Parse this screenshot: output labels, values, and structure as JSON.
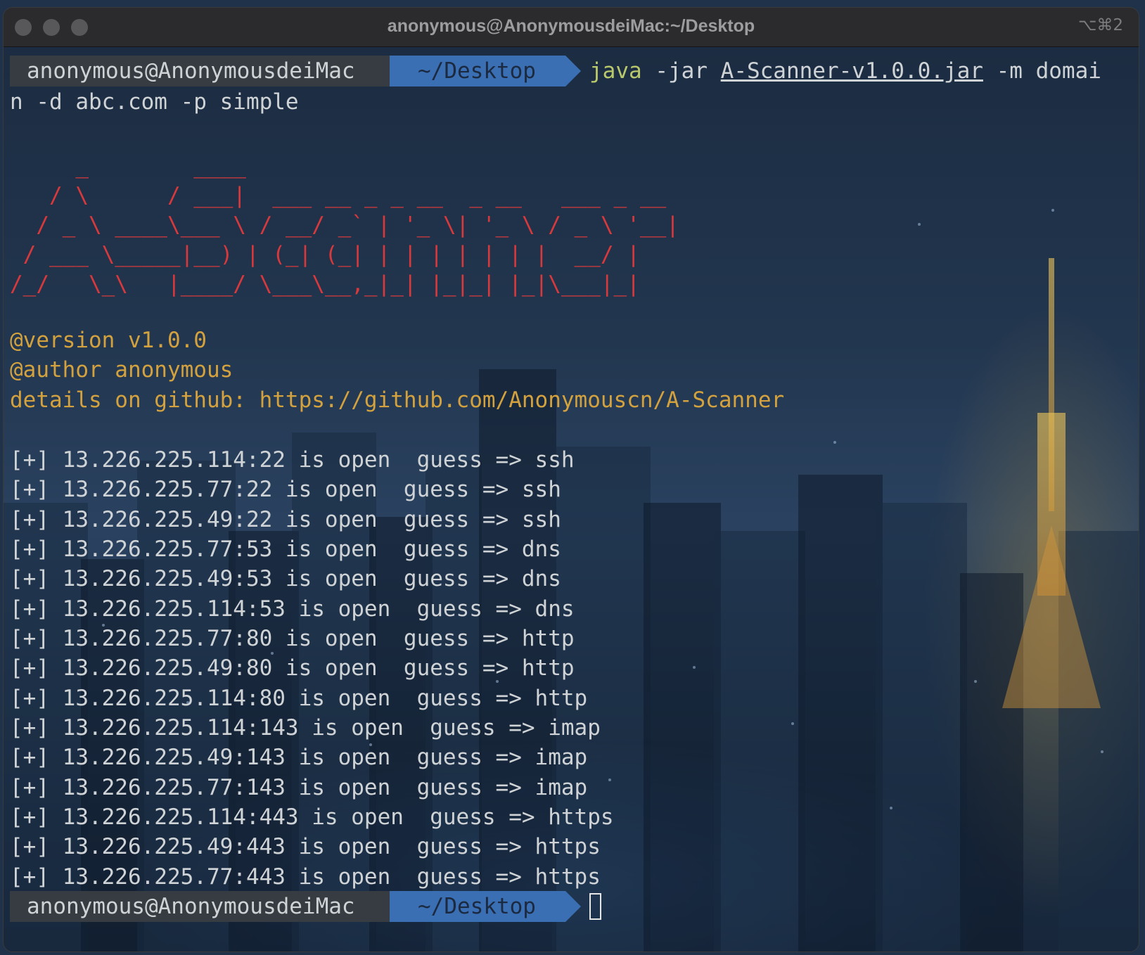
{
  "window": {
    "title": "anonymous@AnonymousdeiMac:~/Desktop",
    "shortcut": "⌥⌘2"
  },
  "prompt": {
    "user_host": "anonymous@AnonymousdeiMac",
    "directory": "~/Desktop"
  },
  "command": {
    "program": "java",
    "flag_jar": "-jar",
    "jar_file": "A-Scanner-v1.0.0.jar",
    "line1_rest": "-m domai",
    "line2": "n -d abc.com -p simple"
  },
  "banner_art": "     _        ____\n   / \\      / ___|  ___ __ _ _ __  _ __   ___ _ __\n  / _ \\ ____\\___ \\ / __/ _` | '_ \\| '_ \\ / _ \\ '__|\n / ___ \\_____|__) | (_| (_| | | | | | | |  __/ |\n/_/   \\_\\   |____/ \\___\\__,_|_| |_|_| |_|\\___|_|",
  "info": {
    "version": "@version v1.0.0",
    "author": "@author anonymous",
    "details": "details on github: https://github.com/Anonymouscn/A-Scanner"
  },
  "results": [
    "[+] 13.226.225.114:22 is open  guess => ssh",
    "[+] 13.226.225.77:22 is open  guess => ssh",
    "[+] 13.226.225.49:22 is open  guess => ssh",
    "[+] 13.226.225.77:53 is open  guess => dns",
    "[+] 13.226.225.49:53 is open  guess => dns",
    "[+] 13.226.225.114:53 is open  guess => dns",
    "[+] 13.226.225.77:80 is open  guess => http",
    "[+] 13.226.225.49:80 is open  guess => http",
    "[+] 13.226.225.114:80 is open  guess => http",
    "[+] 13.226.225.114:143 is open  guess => imap",
    "[+] 13.226.225.49:143 is open  guess => imap",
    "[+] 13.226.225.77:143 is open  guess => imap",
    "[+] 13.226.225.114:443 is open  guess => https",
    "[+] 13.226.225.49:443 is open  guess => https",
    "[+] 13.226.225.77:443 is open  guess => https"
  ],
  "colors": {
    "banner": "#d8393c",
    "info": "#d3a23e",
    "command": "#b9c86b",
    "prompt_user_bg": "#363c42",
    "prompt_dir_bg": "#3b6fb4"
  }
}
